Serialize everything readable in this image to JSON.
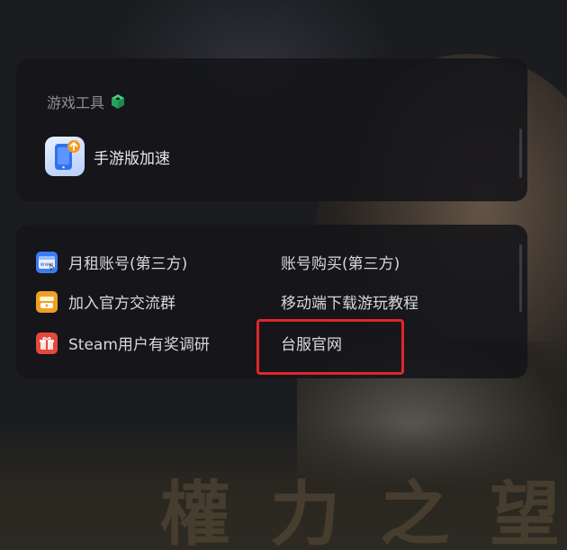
{
  "tools": {
    "section_title": "游戏工具",
    "section_icon": "cube-icon",
    "accent_color": "#2fbf71",
    "items": [
      {
        "label": "手游版加速",
        "icon": "mobile-phone-icon"
      }
    ]
  },
  "links": {
    "items": [
      {
        "label": "月租账号(第三方)",
        "icon": "browser-www-icon",
        "color": "#3b7cf5"
      },
      {
        "label": "账号购买(第三方)"
      },
      {
        "label": "加入官方交流群",
        "icon": "group-chat-icon",
        "color": "#f0a020"
      },
      {
        "label": "移动端下载游玩教程"
      },
      {
        "label": "Steam用户有奖调研",
        "icon": "gift-icon",
        "color": "#e5483c"
      },
      {
        "label": "台服官网"
      }
    ]
  },
  "background": {
    "title_text": "權力之望"
  },
  "highlight": {
    "color": "#e0262a"
  }
}
